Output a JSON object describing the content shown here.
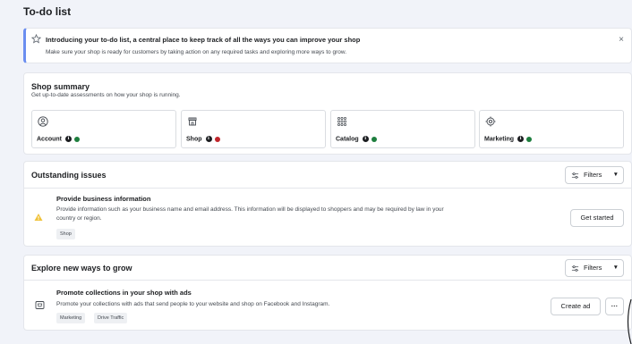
{
  "page": {
    "title": "To-do list"
  },
  "banner": {
    "title": "Introducing your to-do list, a central place to keep track of all the ways you can improve your shop",
    "subtitle": "Make sure your shop is ready for customers by taking action on any required tasks and exploring more ways to grow.",
    "close": "×"
  },
  "summary": {
    "title": "Shop summary",
    "subtitle": "Get up-to-date assessments on how your shop is running.",
    "tiles": [
      {
        "label": "Account",
        "status_color": "#1e7e3e",
        "icon": "person-icon"
      },
      {
        "label": "Shop",
        "status_color": "#c0262c",
        "icon": "storefront-icon"
      },
      {
        "label": "Catalog",
        "status_color": "#1e7e3e",
        "icon": "grid-icon"
      },
      {
        "label": "Marketing",
        "status_color": "#1e7e3e",
        "icon": "target-icon"
      }
    ]
  },
  "issues": {
    "title": "Outstanding issues",
    "filters_label": "Filters",
    "item": {
      "title": "Provide business information",
      "description_line1": "Provide information such as your business name and email address. This information will be displayed to shoppers and may be required by law in your",
      "description_line2": "country or region.",
      "tag": "Shop",
      "action": "Get started"
    }
  },
  "explore": {
    "title": "Explore new ways to grow",
    "filters_label": "Filters",
    "item": {
      "title": "Promote collections in your shop with ads",
      "description": "Promote your collections with ads that send people to your website and shop on Facebook and Instagram.",
      "tags": [
        "Marketing",
        "Drive Traffic"
      ],
      "action": "Create ad",
      "more": "···"
    }
  },
  "colors": {
    "accent": "#6b8ef0",
    "warning": "#f0c23a",
    "success": "#1e7e3e",
    "danger": "#c0262c"
  }
}
